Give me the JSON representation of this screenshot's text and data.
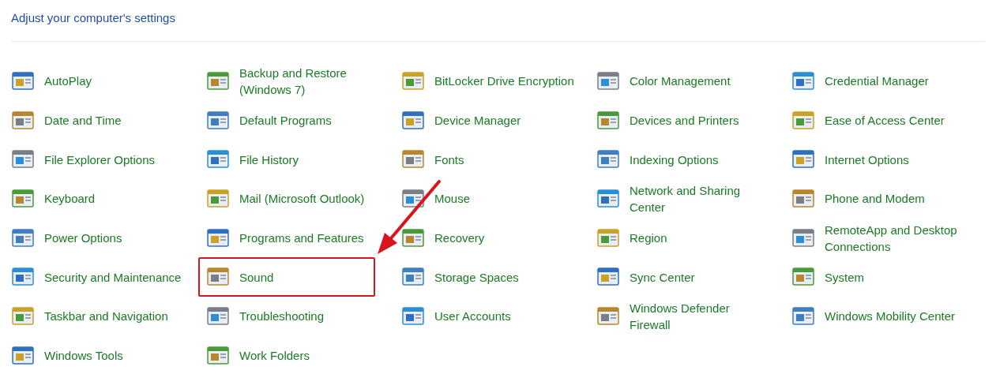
{
  "header": {
    "title": "Adjust your computer's settings"
  },
  "items": [
    {
      "label": "AutoPlay",
      "highlighted": false
    },
    {
      "label": "Backup and Restore (Windows 7)",
      "highlighted": false
    },
    {
      "label": "BitLocker Drive Encryption",
      "highlighted": false
    },
    {
      "label": "Color Management",
      "highlighted": false
    },
    {
      "label": "Credential Manager",
      "highlighted": false
    },
    {
      "label": "Date and Time",
      "highlighted": false
    },
    {
      "label": "Default Programs",
      "highlighted": false
    },
    {
      "label": "Device Manager",
      "highlighted": false
    },
    {
      "label": "Devices and Printers",
      "highlighted": false
    },
    {
      "label": "Ease of Access Center",
      "highlighted": false
    },
    {
      "label": "File Explorer Options",
      "highlighted": false
    },
    {
      "label": "File History",
      "highlighted": false
    },
    {
      "label": "Fonts",
      "highlighted": false
    },
    {
      "label": "Indexing Options",
      "highlighted": false
    },
    {
      "label": "Internet Options",
      "highlighted": false
    },
    {
      "label": "Keyboard",
      "highlighted": false
    },
    {
      "label": "Mail (Microsoft Outlook)",
      "highlighted": false
    },
    {
      "label": "Mouse",
      "highlighted": false
    },
    {
      "label": "Network and Sharing Center",
      "highlighted": false
    },
    {
      "label": "Phone and Modem",
      "highlighted": false
    },
    {
      "label": "Power Options",
      "highlighted": false
    },
    {
      "label": "Programs and Features",
      "highlighted": false
    },
    {
      "label": "Recovery",
      "highlighted": false
    },
    {
      "label": "Region",
      "highlighted": false
    },
    {
      "label": "RemoteApp and Desktop Connections",
      "highlighted": false
    },
    {
      "label": "Security and Maintenance",
      "highlighted": false
    },
    {
      "label": "Sound",
      "highlighted": true
    },
    {
      "label": "Storage Spaces",
      "highlighted": false
    },
    {
      "label": "Sync Center",
      "highlighted": false
    },
    {
      "label": "System",
      "highlighted": false
    },
    {
      "label": "Taskbar and Navigation",
      "highlighted": false
    },
    {
      "label": "Troubleshooting",
      "highlighted": false
    },
    {
      "label": "User Accounts",
      "highlighted": false
    },
    {
      "label": "Windows Defender Firewall",
      "highlighted": false
    },
    {
      "label": "Windows Mobility Center",
      "highlighted": false
    },
    {
      "label": "Windows Tools",
      "highlighted": false
    },
    {
      "label": "Work Folders",
      "highlighted": false
    }
  ]
}
